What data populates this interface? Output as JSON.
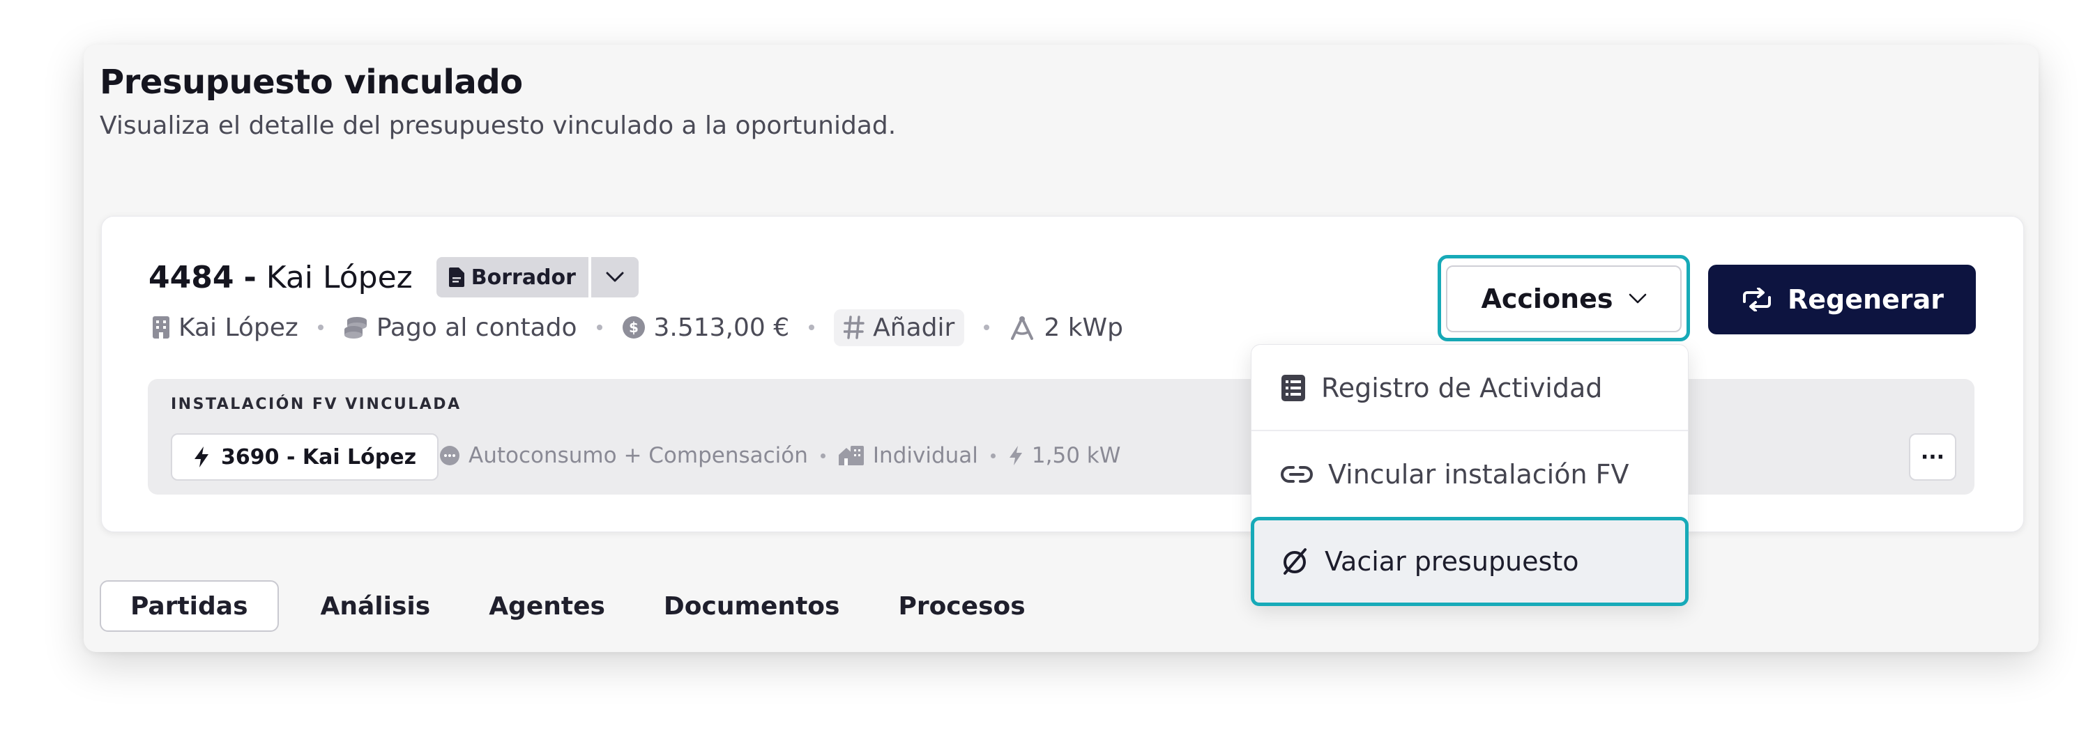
{
  "panel": {
    "title": "Presupuesto vinculado",
    "subtitle": "Visualiza el detalle del presupuesto vinculado a la oportunidad."
  },
  "budget": {
    "number": "4484",
    "dash": "-",
    "client": "Kai López",
    "status": "Borrador",
    "meta": {
      "company": "Kai López",
      "payment": "Pago al contado",
      "amount": "3.513,00 €",
      "tag": "Añadir",
      "power": "2 kWp"
    }
  },
  "installation": {
    "section_label": "INSTALACIÓN FV VINCULADA",
    "pill": "3690 - Kai López",
    "mode": "Autoconsumo + Compensación",
    "type": "Individual",
    "power": "1,50 kW",
    "more_label": "···"
  },
  "actions": {
    "button_label": "Acciones",
    "regenerate_label": "Regenerar",
    "menu": [
      {
        "label": "Registro de Actividad",
        "icon": "list-icon"
      },
      {
        "label": "Vincular instalación FV",
        "icon": "link-icon"
      },
      {
        "label": "Vaciar presupuesto",
        "icon": "empty-set-icon"
      }
    ]
  },
  "tabs": [
    "Partidas",
    "Análisis",
    "Agentes",
    "Documentos",
    "Procesos"
  ],
  "colors": {
    "accent_focus": "#17aab8",
    "primary_button": "#0d1440",
    "panel_bg": "#f6f6f6"
  }
}
